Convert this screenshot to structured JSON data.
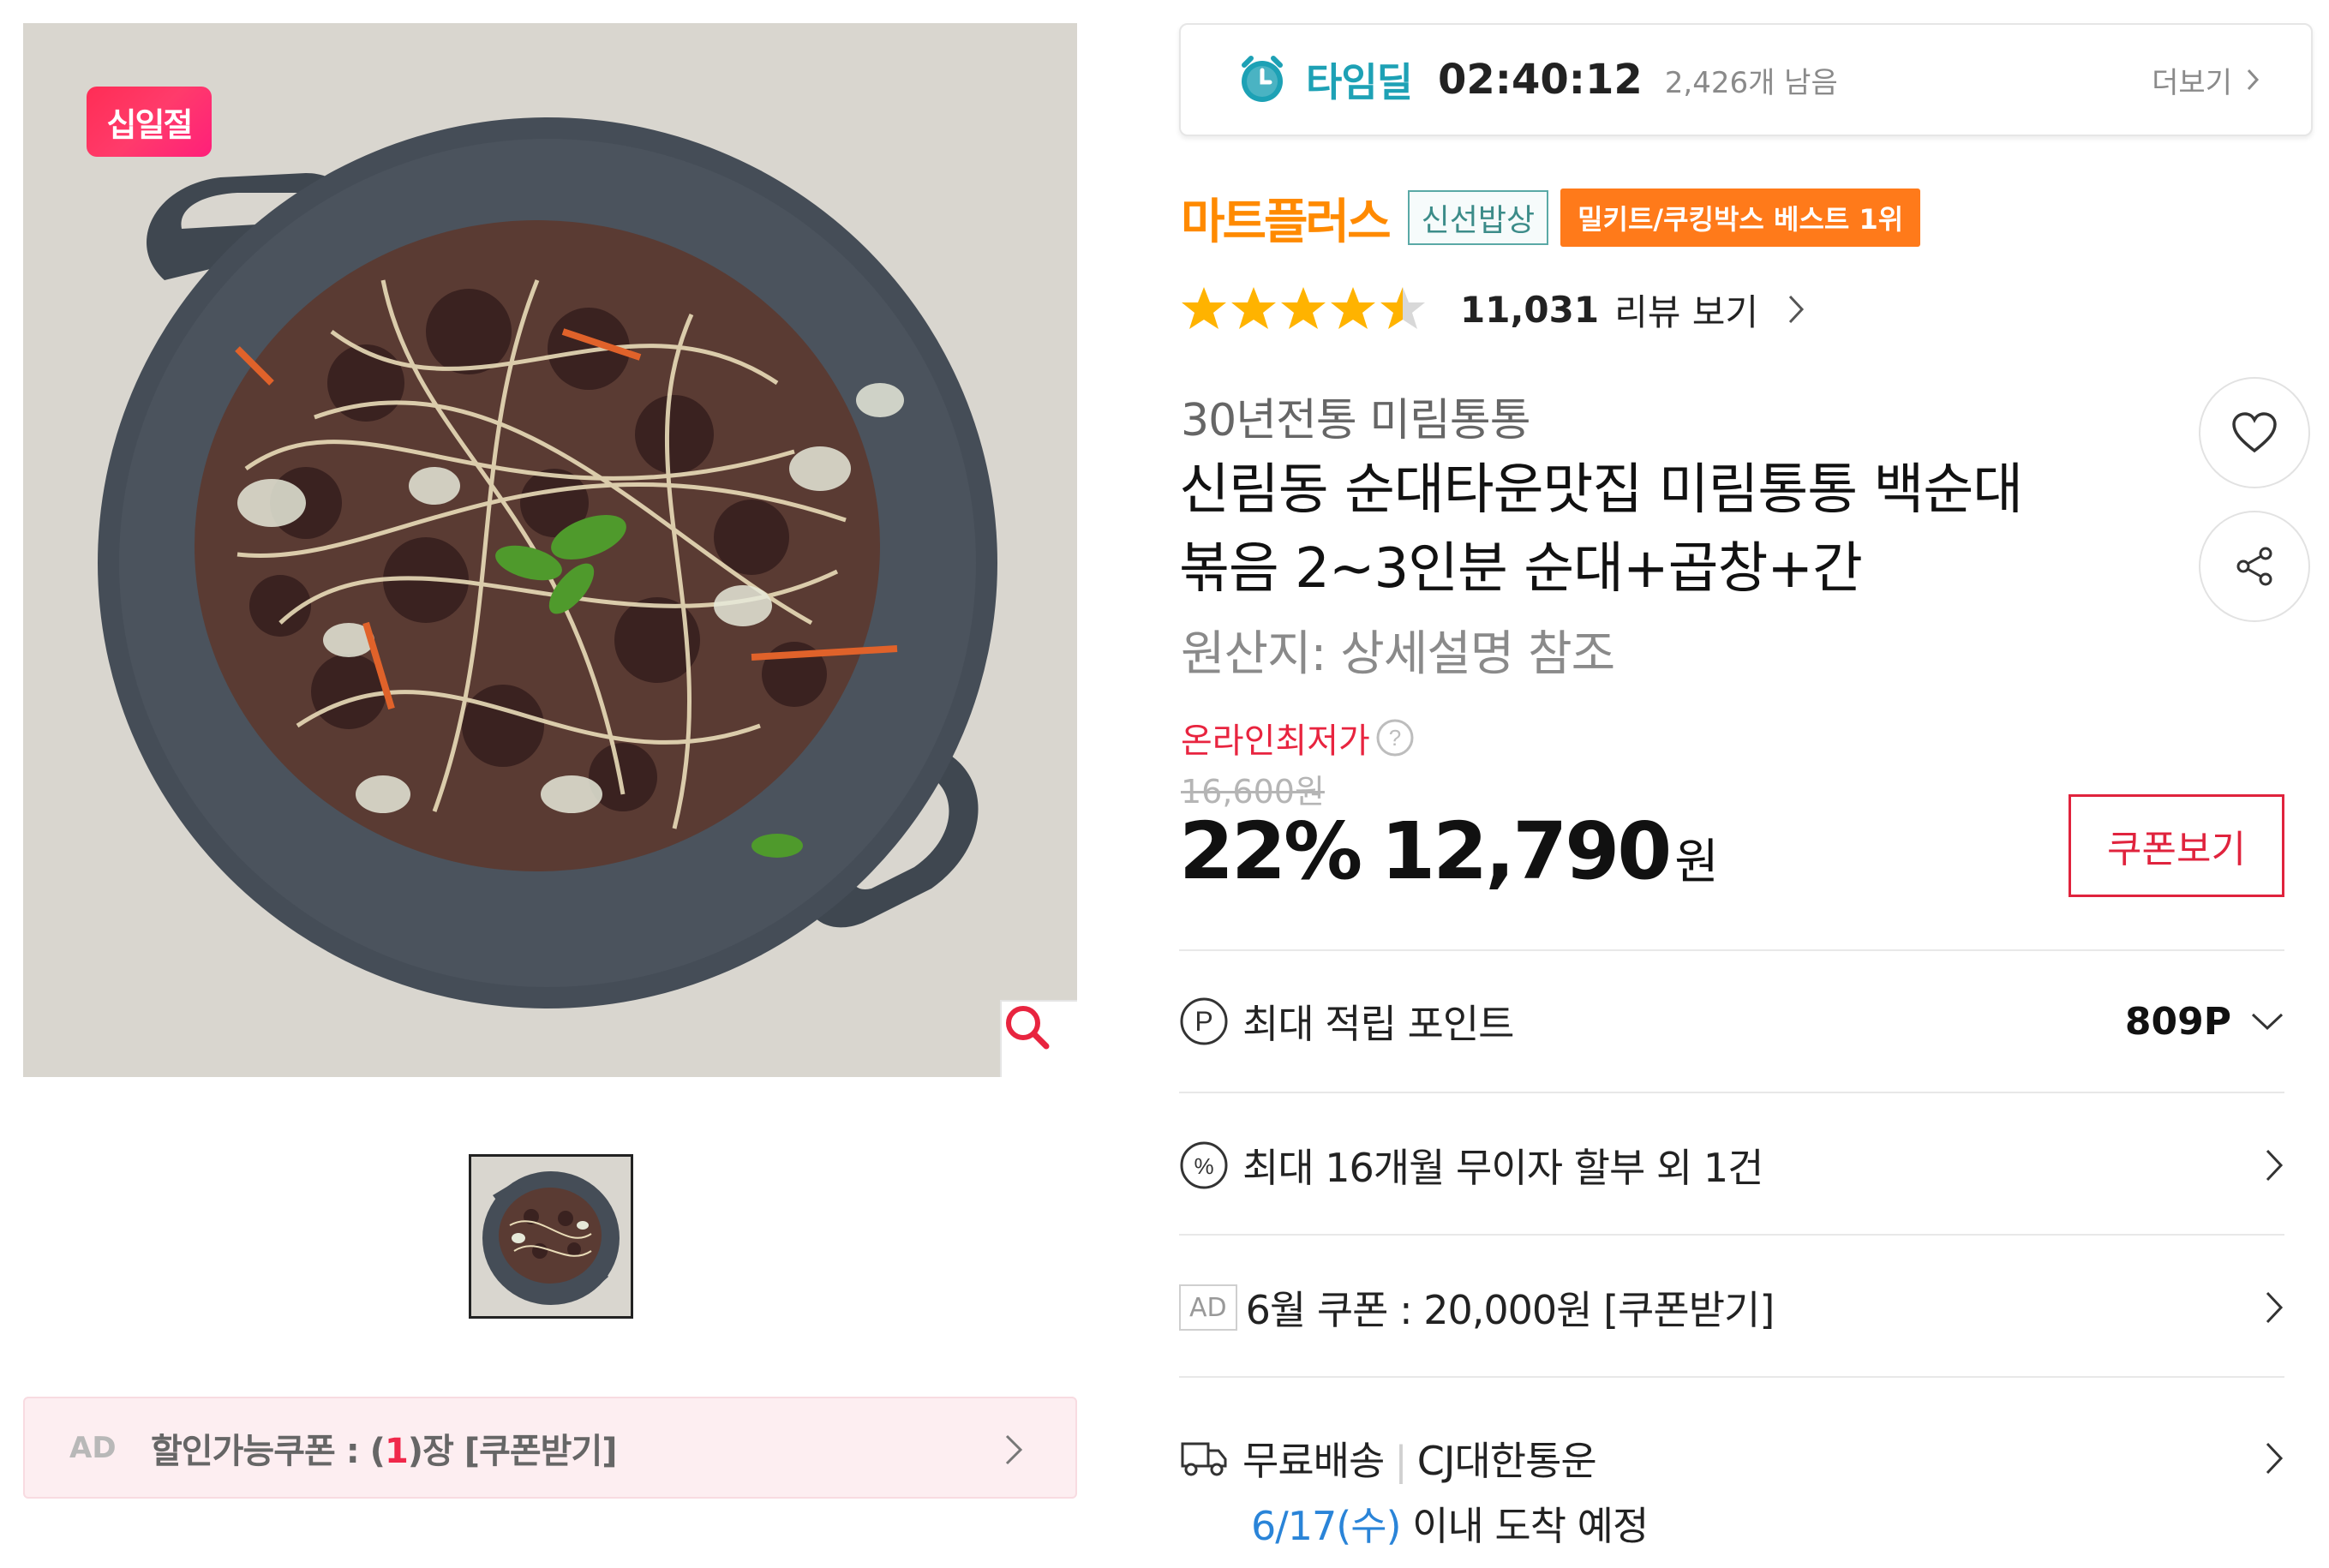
{
  "gallery": {
    "promo_badge": "십일절",
    "zoom_icon": "search-icon",
    "coupon_bar": {
      "ad_label": "AD",
      "text_before": "할인가능쿠폰 : (",
      "count": "1",
      "text_after": ")장 [쿠폰받기]"
    }
  },
  "timedeal": {
    "label": "타임딜",
    "timer": "02:40:12",
    "remaining": "2,426개 남음",
    "more_label": "더보기",
    "accent": "#1da1b5"
  },
  "brand": {
    "name": "마트플러스",
    "tag_fresh": "신선밥상",
    "tag_best": "밀키트/쿠킹박스 베스트 1위",
    "brand_color": "#ff8a00"
  },
  "rating": {
    "stars": 4.5,
    "review_count": "11,031",
    "review_link": "리뷰 보기"
  },
  "product": {
    "subtitle": "30년전통 미림통통",
    "title_line1": "신림동 순대타운맛집 미림통통 백순대",
    "title_line2": "볶음 2~3인분 순대+곱창+간",
    "origin": "원산지:  상세설명 참조"
  },
  "price": {
    "lowest_label": "온라인최저가",
    "original": "16,600원",
    "discount": "22%",
    "sale": "12,790",
    "currency": "원",
    "coupon_button": "쿠폰보기",
    "accent": "#e0233d"
  },
  "benefits": {
    "points_label": "최대 적립 포인트",
    "points_value": "809P",
    "installment_label": "최대 16개월 무이자 할부 외 1건",
    "coupon_ad": "AD",
    "coupon_label": "6월 쿠폰 : 20,000원 [쿠폰받기]",
    "shipping_label": "무료배송",
    "carrier": "CJ대한통운",
    "arrival_date": "6/17(수)",
    "arrival_text": " 이내 도착 예정"
  }
}
